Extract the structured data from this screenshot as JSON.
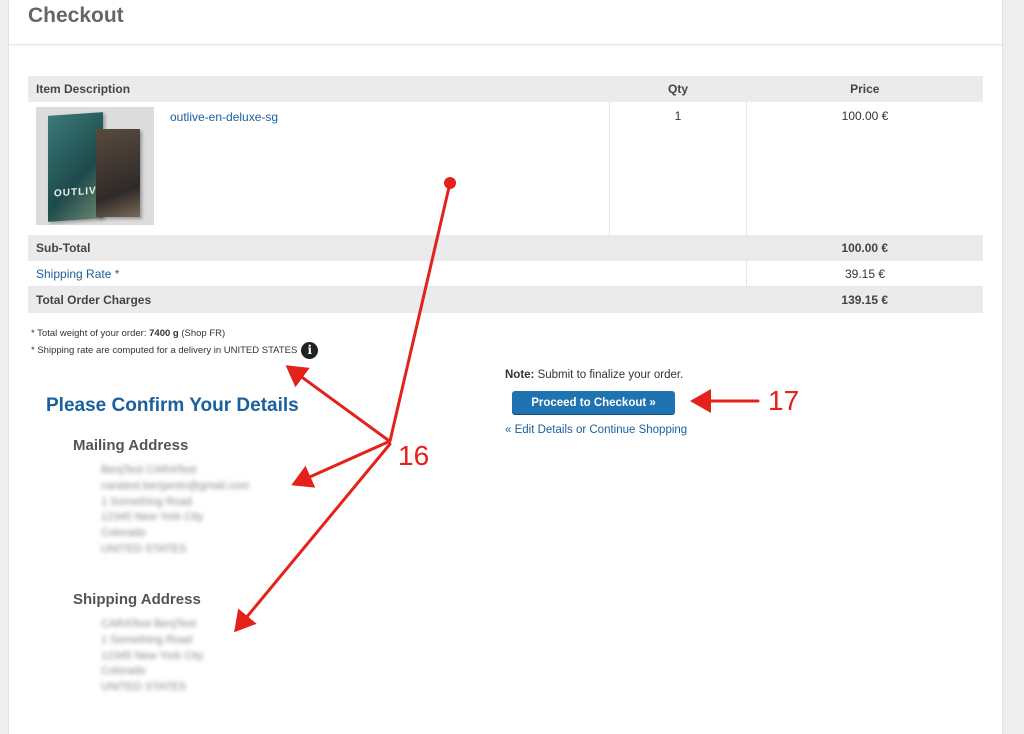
{
  "page": {
    "title": "Checkout"
  },
  "cart": {
    "headers": {
      "description": "Item Description",
      "qty": "Qty",
      "price": "Price"
    },
    "item": {
      "name": "outlive-en-deluxe-sg",
      "qty": "1",
      "price": "100.00 €",
      "box_text": "OUTLIVE"
    },
    "subtotal": {
      "label": "Sub-Total",
      "value": "100.00 €"
    },
    "shipping": {
      "label": "Shipping Rate *",
      "value": "39.15 €"
    },
    "total": {
      "label": "Total Order Charges",
      "value": "139.15 €"
    }
  },
  "notes": {
    "weight_prefix": "* Total weight of your order: ",
    "weight_value": "7400 g",
    "weight_suffix": " (Shop FR)",
    "shipping_note": "* Shipping rate are computed for a delivery in UNITED STATES",
    "info_glyph": "i"
  },
  "confirm": {
    "title": "Please Confirm Your Details",
    "mailing_title": "Mailing Address",
    "mailing_lines": [
      "BenjTest CARATest",
      "caratest.benjamin@gmail.com",
      "1 Something Road",
      "12345 New York City",
      "Colorado",
      "UNITED STATES"
    ],
    "shipping_title": "Shipping Address",
    "shipping_lines": [
      "CARATest BenjTest",
      "1 Something Road",
      "12345 New York City",
      "Colorado",
      "UNITED STATES"
    ]
  },
  "actions": {
    "note_bold": "Note:",
    "note_text": " Submit to finalize your order.",
    "proceed_label": "Proceed to Checkout »",
    "edit_link": "« Edit Details or Continue Shopping"
  },
  "annotations": {
    "label_16": "16",
    "label_17": "17",
    "color": "#e4211b"
  }
}
